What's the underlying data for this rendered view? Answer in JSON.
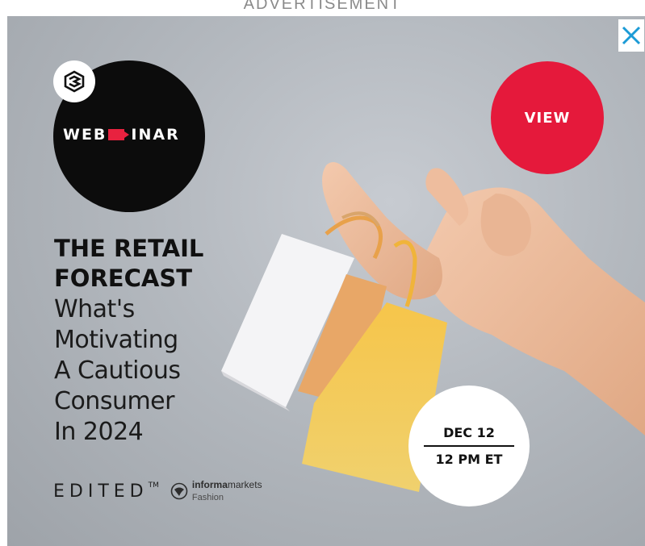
{
  "advertisement_label": "ADVERTISEMENT",
  "close_button": {
    "icon": "close-icon",
    "color": "#1c9bd6"
  },
  "ad": {
    "webinar_badge": {
      "logo_icon": "informa-s-logo-icon",
      "word_left": "WEB",
      "word_right": "INAR",
      "camera_icon": "camera-icon"
    },
    "view_button_label": "VIEW",
    "headline_lines": [
      "THE RETAIL",
      "FORECAST"
    ],
    "subhead_lines": [
      "What's",
      "Motivating",
      "A Cautious",
      "Consumer",
      "In 2024"
    ],
    "sponsors": {
      "edited_logo": "EDITED",
      "edited_tm": "TM",
      "informa_bold": "informa",
      "informa_regular": "markets",
      "informa_sub": "Fashion"
    },
    "event": {
      "date": "DEC 12",
      "time": "12 PM ET"
    },
    "colors": {
      "accent_red": "#e5193b",
      "background": "#b3b8be",
      "disc_black": "#0c0c0c"
    }
  }
}
